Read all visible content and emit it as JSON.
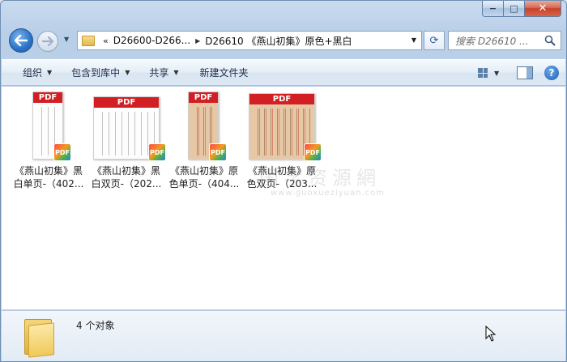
{
  "window": {
    "caption_buttons": {
      "minimize": "−",
      "maximize": "□",
      "close": "✕"
    }
  },
  "nav": {
    "back_icon": "back-arrow-icon",
    "forward_icon": "forward-arrow-icon",
    "address": {
      "overflow_chevron": "«",
      "crumbs": [
        "D26600-D266...",
        "D26610 《燕山初集》原色+黑白"
      ]
    },
    "search_placeholder": "搜索 D26610 ..."
  },
  "toolbar": {
    "organize": "组织",
    "include_in_library": "包含到库中",
    "share": "共享",
    "new_folder": "新建文件夹"
  },
  "files": [
    {
      "line1": "《燕山初集》黑",
      "line2": "白单页-（402...",
      "thumb_label": "PDF",
      "style": "bw-single",
      "badge": "PDF"
    },
    {
      "line1": "《燕山初集》黑",
      "line2": "白双页-（202...",
      "thumb_label": "PDF",
      "style": "bw-double",
      "badge": "PDF"
    },
    {
      "line1": "《燕山初集》原",
      "line2": "色单页-（404...",
      "thumb_label": "PDF",
      "style": "color-single",
      "badge": "PDF"
    },
    {
      "line1": "《燕山初集》原",
      "line2": "色双页-（203...",
      "thumb_label": "PDF",
      "style": "color-double",
      "badge": "PDF"
    }
  ],
  "watermark": {
    "main": "国学资源網",
    "sub": "www.guoxueziyuan.com"
  },
  "status": {
    "count_text": "4 个对象"
  },
  "colors": {
    "pdf_red": "#d21f23",
    "frame_blue": "#b9cfe8"
  }
}
